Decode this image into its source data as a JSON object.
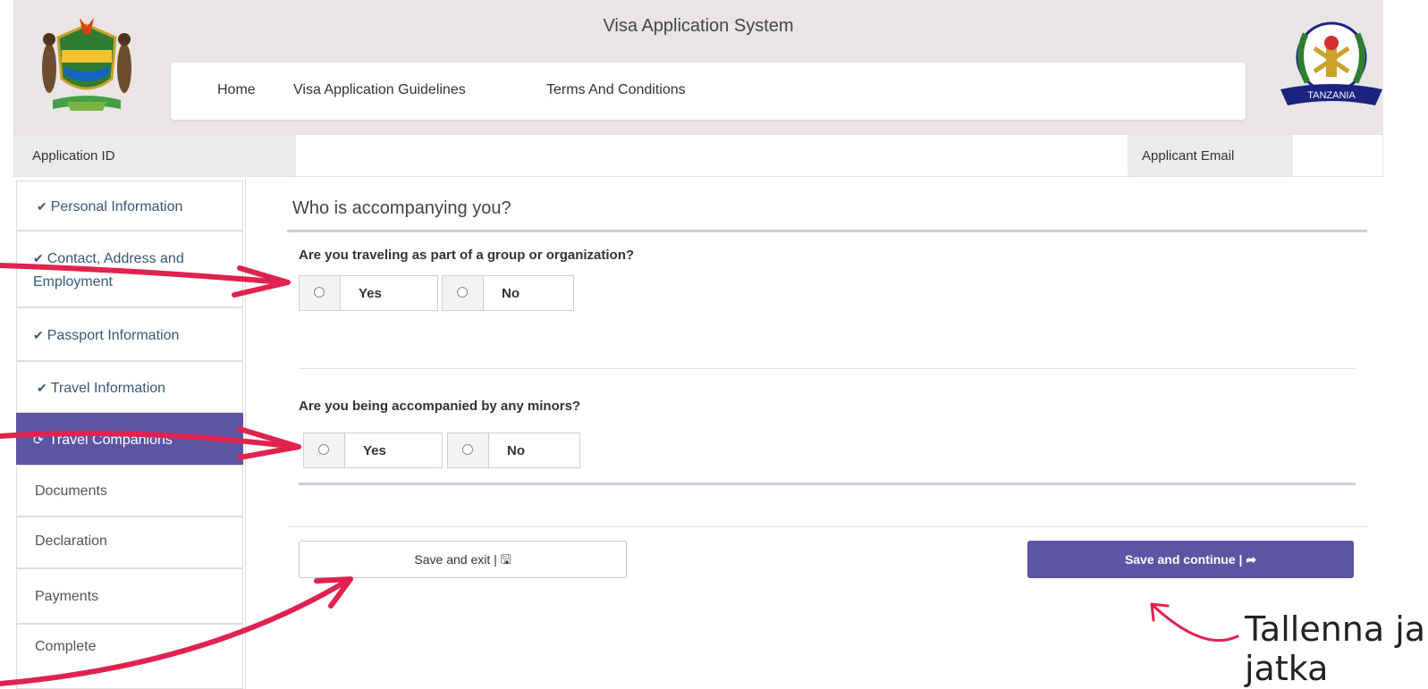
{
  "header": {
    "title": "Visa Application System",
    "nav": [
      "Home",
      "Visa Application Guidelines",
      "Terms And Conditions"
    ],
    "left_logo": "coat-of-arms-logo",
    "right_logo": "immigration-tanzania-logo",
    "right_logo_text": "TANZANIA"
  },
  "infobar": {
    "application_id_label": "Application ID",
    "applicant_email_label": "Applicant Email"
  },
  "sidebar": {
    "items": [
      {
        "label": "Personal Information",
        "state": "done"
      },
      {
        "label": "Contact, Address and Employment",
        "state": "done"
      },
      {
        "label": "Passport Information",
        "state": "done"
      },
      {
        "label": "Travel Information",
        "state": "done"
      },
      {
        "label": "Travel Companions",
        "state": "active"
      },
      {
        "label": "Documents",
        "state": "todo"
      },
      {
        "label": "Declaration",
        "state": "todo"
      },
      {
        "label": "Payments",
        "state": "todo"
      },
      {
        "label": "Complete",
        "state": "todo"
      }
    ]
  },
  "main": {
    "section_title": "Who is accompanying you?",
    "questions": [
      {
        "text": "Are you traveling as part of a group or organization?",
        "options": [
          "Yes",
          "No"
        ]
      },
      {
        "text": "Are you being accompanied by any minors?",
        "options": [
          "Yes",
          "No"
        ]
      }
    ],
    "save_exit_label": "Save and exit | 🖫",
    "save_continue_label": "Save and continue | ➦"
  },
  "annotation": {
    "text": "Tallenna ja\njatka",
    "color": "#e0234e"
  },
  "colors": {
    "primary": "#5d54a4",
    "link": "#36587a",
    "header_bg": "#e8e5e4"
  }
}
